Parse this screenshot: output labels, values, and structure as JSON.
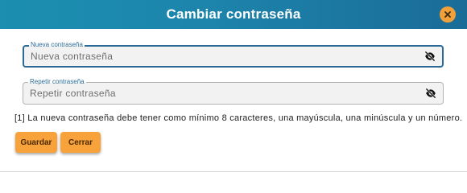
{
  "dialog": {
    "title": "Cambiar contraseña",
    "close_icon": "close-icon"
  },
  "fields": [
    {
      "label": "Nueva contraseña",
      "placeholder": "Nueva contraseña",
      "value": "",
      "icon": "eye-off-icon"
    },
    {
      "label": "Repetir contraseña",
      "placeholder": "Repetir contraseña",
      "value": "",
      "icon": "eye-off-icon"
    }
  ],
  "note": "[1] La nueva contraseña debe tener como mínimo 8 caracteres, una mayúscula, una minúscula y un número.",
  "buttons": {
    "save_label": "Guardar",
    "cancel_label": "Cerrar"
  },
  "colors": {
    "header": "#1d84ab",
    "button": "#f7a23b",
    "close_button": "#f2a13a",
    "focused_border": "#2b6a96"
  }
}
